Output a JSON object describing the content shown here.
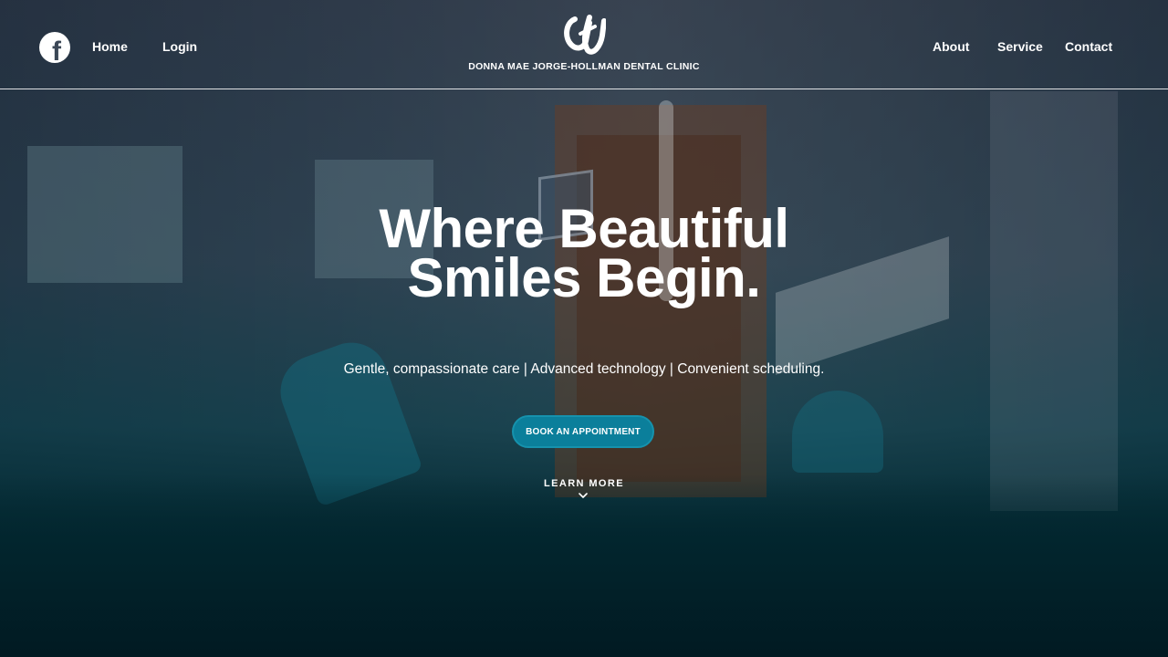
{
  "header": {
    "social_icon": "facebook-icon",
    "nav_left": [
      {
        "label": "Home"
      },
      {
        "label": "Login"
      }
    ],
    "nav_right": [
      {
        "label": "About"
      },
      {
        "label": "Service"
      },
      {
        "label": "Contact"
      }
    ],
    "logo_icon": "dj-monogram-logo",
    "clinic_name": "DONNA MAE JORGE-HOLLMAN DENTAL CLINIC"
  },
  "hero": {
    "title_line1": "Where Beautiful",
    "title_line2": "Smiles Begin.",
    "subtitle": "Gentle, compassionate care | Advanced technology | Convenient scheduling.",
    "cta_label": "BOOK AN APPOINTMENT",
    "learn_more_label": "LEARN MORE",
    "learn_more_icon": "chevron-down-icon"
  },
  "colors": {
    "accent": "#0b7f9b",
    "text": "#ffffff",
    "background_bottom": "#011a22"
  }
}
